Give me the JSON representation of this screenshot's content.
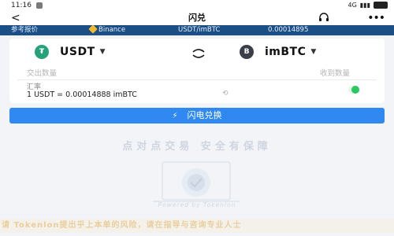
{
  "status": {
    "time": "11:16",
    "network": "4G"
  },
  "nav": {
    "title": "闪兑"
  },
  "ticker": {
    "tag": "参考报价",
    "exchange": "Binance",
    "pair": "USDT/imBTC",
    "price": "0.00014895"
  },
  "swap": {
    "from": {
      "symbol": "USDT",
      "logo_text": "₮",
      "qty_label": "交出数量"
    },
    "to": {
      "symbol": "imBTC",
      "logo_text": "B",
      "qty_label": "收到数量"
    },
    "rate_label": "汇率",
    "rate_value": "1 USDT = 0.00014888 imBTC",
    "toggle_on": true
  },
  "button": {
    "label": "闪电兑换"
  },
  "slogan": "点对点交易 安全有保障",
  "powered_by": "Powered by Tokenlon",
  "marquee": "请 Tokenlon提出乎上本单的风险，请在指导与咨询专业人士",
  "colors": {
    "accent": "#2f89f0",
    "ticker_bg": "#1b4f86",
    "usdt": "#26a17b",
    "toggle_on": "#2bc760"
  }
}
